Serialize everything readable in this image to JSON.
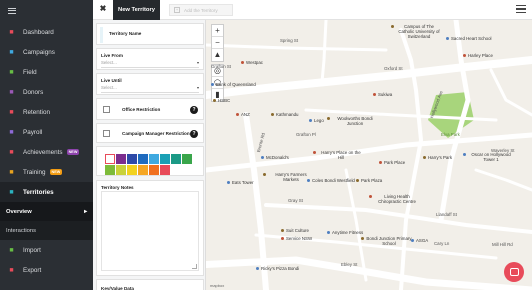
{
  "sidebar": {
    "items": [
      {
        "label": "Dashboard",
        "icon": "home-icon",
        "color": "#e84b5a"
      },
      {
        "label": "Campaigns",
        "icon": "flag-icon",
        "color": "#3fa9e0"
      },
      {
        "label": "Field",
        "icon": "map-icon",
        "color": "#67bd45"
      },
      {
        "label": "Donors",
        "icon": "donor-icon",
        "color": "#9b59b6"
      },
      {
        "label": "Retention",
        "icon": "retention-icon",
        "color": "#e84b5a"
      },
      {
        "label": "Payroll",
        "icon": "dollar-icon",
        "color": "#8e6ad8"
      },
      {
        "label": "Achievements",
        "icon": "trophy-icon",
        "color": "#e84b5a",
        "badge": "NEW",
        "badge_color": "#8e44ad"
      },
      {
        "label": "Training",
        "icon": "training-icon",
        "color": "#e8a21f",
        "badge": "NEW",
        "badge_color": "#f39c12"
      },
      {
        "label": "Territories",
        "icon": "territory-icon",
        "color": "#2bb3c0"
      }
    ],
    "subitems": [
      {
        "label": "Overview"
      },
      {
        "label": "Interactions"
      }
    ],
    "bottom_items": [
      {
        "label": "Import",
        "icon": "import-icon",
        "color": "#67bd45"
      },
      {
        "label": "Export",
        "icon": "export-icon",
        "color": "#e84b5a"
      }
    ]
  },
  "topbar": {
    "tab_label": "New Territory",
    "add_tab_label": "Add the Territory"
  },
  "form": {
    "territory_name_label": "Territory Name",
    "live_from_label": "Live From",
    "live_from_placeholder": "Select...",
    "live_until_label": "Live Until",
    "live_until_placeholder": "Select...",
    "office_restriction_label": "Office Restriction",
    "campaign_manager_label": "Campaign Manager Restriction",
    "colors": [
      "#ffffff",
      "#7b2d8e",
      "#2e4aa8",
      "#1f6bbf",
      "#3fa9e0",
      "#1aa0b5",
      "#1b9a86",
      "#3aa64b",
      "#7dbb3a",
      "#c9d23a",
      "#f2d21f",
      "#f5a623",
      "#f07020",
      "#e84b5a"
    ],
    "territory_notes_label": "Territory Notes",
    "key_value_label": "Key/Value Data"
  },
  "map": {
    "labels": [
      {
        "text": "Campus of The Catholic University of Switzerland",
        "kind": "poi"
      },
      {
        "text": "Sacred Heart School",
        "kind": "poi"
      },
      {
        "text": "Westpac",
        "kind": "poi"
      },
      {
        "text": "HSBC",
        "kind": "poi"
      },
      {
        "text": "Bank of Queensland",
        "kind": "poi"
      },
      {
        "text": "ANZ",
        "kind": "poi"
      },
      {
        "text": "Kathmandu",
        "kind": "poi"
      },
      {
        "text": "Lego",
        "kind": "poi"
      },
      {
        "text": "Sukiwa",
        "kind": "poi"
      },
      {
        "text": "Woolworths Bondi Junction",
        "kind": "poi"
      },
      {
        "text": "McDonald's",
        "kind": "poi"
      },
      {
        "text": "Harry's Place on the Hill",
        "kind": "poi"
      },
      {
        "text": "Harry's Park",
        "kind": "poi"
      },
      {
        "text": "Oscar on Hollywood Tower 1",
        "kind": "poi"
      },
      {
        "text": "Elva Park",
        "kind": "park"
      },
      {
        "text": "Harry's Farmers Markets",
        "kind": "poi"
      },
      {
        "text": "Coles Bondi Westfield",
        "kind": "poi"
      },
      {
        "text": "Park Place",
        "kind": "poi"
      },
      {
        "text": "Park Plaza",
        "kind": "poi"
      },
      {
        "text": "Eats Tower",
        "kind": "poi"
      },
      {
        "text": "Living Health Chiropractic Centre",
        "kind": "poi"
      },
      {
        "text": "Suit Culture",
        "kind": "poi"
      },
      {
        "text": "Anytime Fitness",
        "kind": "poi"
      },
      {
        "text": "Service NSW",
        "kind": "poi"
      },
      {
        "text": "Bondi Junction Primary School",
        "kind": "poi"
      },
      {
        "text": "Ricky's Pizza Bondi",
        "kind": "poi"
      },
      {
        "text": "Ebley St",
        "kind": "street"
      },
      {
        "text": "Oxford St",
        "kind": "street"
      },
      {
        "text": "Waverley St",
        "kind": "street"
      },
      {
        "text": "Grafton St",
        "kind": "street"
      },
      {
        "text": "Gray St",
        "kind": "street"
      },
      {
        "text": "Llandaff St",
        "kind": "street"
      },
      {
        "text": "Cary Ln",
        "kind": "street"
      },
      {
        "text": "Bronte Rd",
        "kind": "street"
      },
      {
        "text": "Hollywood Ave",
        "kind": "street"
      },
      {
        "text": "Spring St",
        "kind": "street"
      },
      {
        "text": "Mill Hill Rd",
        "kind": "street"
      },
      {
        "text": "ASGA",
        "kind": "poi"
      },
      {
        "text": "Harley Place",
        "kind": "poi"
      },
      {
        "text": "Grafton Pl",
        "kind": "street"
      }
    ],
    "attribution": "mapbox"
  }
}
